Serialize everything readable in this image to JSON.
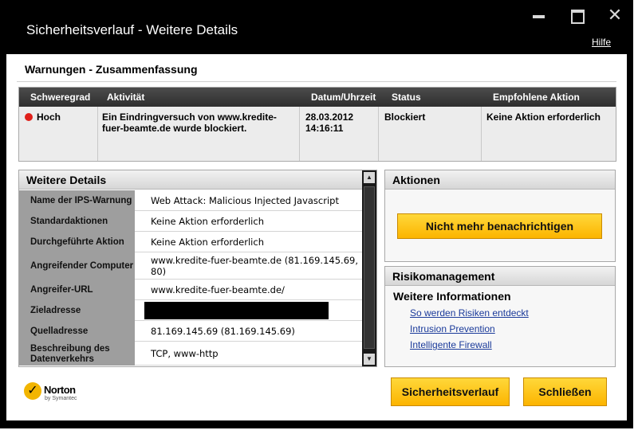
{
  "window": {
    "title": "Sicherheitsverlauf - Weitere Details",
    "help": "Hilfe"
  },
  "summary": {
    "title": "Warnungen - Zusammenfassung",
    "headers": [
      "Schweregrad",
      "Aktivität",
      "Datum/Uhrzeit",
      "Status",
      "Empfohlene Aktion"
    ],
    "row": {
      "severity": "Hoch",
      "activity_line1": "Ein Eindringversuch von www.kredite-",
      "activity_line2": "fuer-beamte.de wurde blockiert.",
      "date": "28.03.2012",
      "time": "14:16:11",
      "status": "Blockiert",
      "action": "Keine Aktion erforderlich"
    }
  },
  "details": {
    "title": "Weitere Details",
    "rows": [
      {
        "label": "Name der IPS-Warnung",
        "value": "Web Attack: Malicious Injected Javascript"
      },
      {
        "label": "Standardaktionen",
        "value": "Keine Aktion erforderlich"
      },
      {
        "label": "Durchgeführte Aktion",
        "value": "Keine Aktion erforderlich"
      },
      {
        "label": "Angreifender Computer",
        "value": "www.kredite-fuer-beamte.de (81.169.145.69, 80)"
      },
      {
        "label": "Angreifer-URL",
        "value": "www.kredite-fuer-beamte.de/"
      },
      {
        "label": "Zieladresse",
        "value": ""
      },
      {
        "label": "Quelladresse",
        "value": "81.169.145.69 (81.169.145.69)"
      },
      {
        "label": "Beschreibung des Datenverkehrs",
        "value": "TCP, www-http"
      }
    ]
  },
  "actions": {
    "title": "Aktionen",
    "notify_button": "Nicht mehr benachrichtigen"
  },
  "risk": {
    "title": "Risikomanagement",
    "subtitle": "Weitere Informationen",
    "links": [
      "So werden Risiken entdeckt",
      "Intrusion Prevention",
      "Intelligente Firewall"
    ]
  },
  "footer": {
    "logo_name": "Norton",
    "logo_sub": "by Symantec",
    "history_button": "Sicherheitsverlauf",
    "close_button": "Schließen"
  },
  "colors": {
    "accent": "#fcb400",
    "severity_high": "#e0201a",
    "link": "#1a3a9a"
  }
}
